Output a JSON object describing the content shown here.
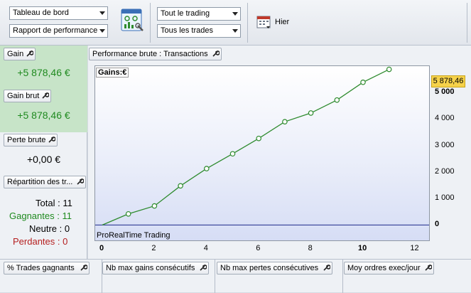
{
  "toolbar": {
    "select_view": "Tableau de bord",
    "select_report": "Rapport de performance",
    "select_trading": "Tout le trading",
    "select_trades": "Tous les trades",
    "period_label": "Hier"
  },
  "left": {
    "gain_label": "Gain",
    "gain_value": "+5 878,46 €",
    "gain_brut_label": "Gain brut",
    "gain_brut_value": "+5 878,46 €",
    "perte_brute_label": "Perte brute",
    "perte_brute_value": "+0,00 €",
    "repartition_label": "Répartition des tr...",
    "total_label": "Total",
    "total_value": "11",
    "gagnantes_label": "Gagnantes",
    "gagnantes_value": "11",
    "neutre_label": "Neutre",
    "neutre_value": "0",
    "perdantes_label": "Perdantes",
    "perdantes_value": "0",
    "sep": ":"
  },
  "chart": {
    "tab_label": "Performance brute : Transactions",
    "legend": "Gains:€",
    "watermark": "ProRealTime Trading",
    "last_value_label": "5 878,46"
  },
  "chart_data": {
    "type": "line",
    "x": [
      0,
      1,
      2,
      3,
      4,
      5,
      6,
      7,
      8,
      9,
      10,
      11
    ],
    "series": [
      {
        "values": [
          0,
          420,
          720,
          1480,
          2130,
          2690,
          3270,
          3900,
          4230,
          4720,
          5390,
          5878.46
        ]
      }
    ],
    "xlim": [
      0,
      12.5
    ],
    "ylim": [
      -580,
      6000
    ],
    "x_ticks": [
      "0",
      "2",
      "4",
      "6",
      "8",
      "10",
      "12"
    ],
    "y_ticks": [
      "0",
      "1 000",
      "2 000",
      "3 000",
      "4 000",
      "5 000"
    ],
    "colors": {
      "line": "#2e8b2e",
      "zero_line": "#1c2a8a",
      "marker_fill": "#ffffff"
    }
  },
  "bottom": {
    "trades_gagnants": "% Trades gagnants",
    "max_gains": "Nb max gains consécutifs",
    "max_pertes": "Nb max pertes consécutives",
    "moy_ordres": "Moy ordres exec/jour"
  },
  "colors": {
    "gain_green": "#1f8a1f",
    "perdantes_red": "#b52020",
    "highlight": "#f6d24a"
  }
}
